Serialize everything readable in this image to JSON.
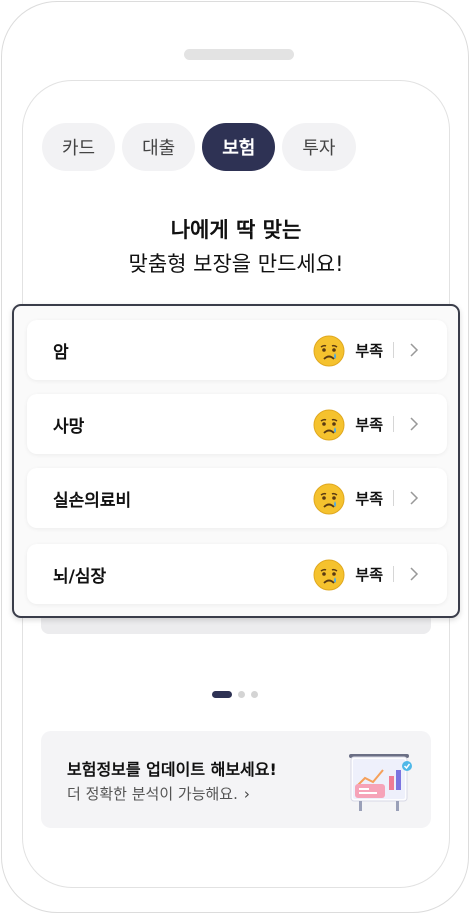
{
  "tabs": [
    {
      "label": "카드",
      "active": false
    },
    {
      "label": "대출",
      "active": false
    },
    {
      "label": "보험",
      "active": true
    },
    {
      "label": "투자",
      "active": false
    }
  ],
  "heading": {
    "line1": "나에게 딱 맞는",
    "line2": "맞춤형 보장을 만드세요!"
  },
  "coverage_items": [
    {
      "label": "암",
      "status": "부족"
    },
    {
      "label": "사망",
      "status": "부족"
    },
    {
      "label": "실손의료비",
      "status": "부족"
    },
    {
      "label": "뇌/심장",
      "status": "부족"
    }
  ],
  "pagination": {
    "total": 3,
    "current": 1
  },
  "banner": {
    "title": "보험정보를 업데이트 해보세요!",
    "subtitle": "더 정확한 분석이 가능해요.",
    "chevron": "›"
  },
  "colors": {
    "accent": "#2e3254",
    "tab_bg": "#f2f2f4",
    "banner_bg": "#f4f4f6",
    "face": "#f5c22e"
  },
  "icons": {
    "status_face": "crying-face-icon",
    "row_arrow": "chevron-right-icon",
    "banner_art": "chart-presentation-icon"
  }
}
